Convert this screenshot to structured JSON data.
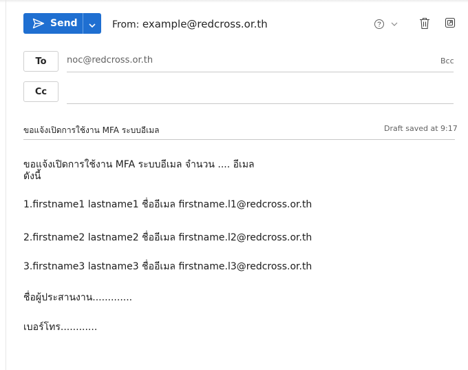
{
  "toolbar": {
    "send_label": "Send",
    "from_prefix": "From:",
    "from_address": "example@redcross.or.th",
    "icons": [
      "send-icon",
      "chevron-down-icon",
      "help-shield-icon",
      "chevron-down-icon",
      "trash-icon",
      "popout-icon"
    ]
  },
  "recipients": {
    "to_label": "To",
    "to_value": "noc@redcross.or.th",
    "cc_label": "Cc",
    "cc_value": "",
    "bcc_label": "Bcc"
  },
  "subject": {
    "value": "ขอแจ้งเปิดการใช้งาน MFA ระบบอีเมล",
    "draft_status": "Draft saved at 9:17"
  },
  "body": {
    "line1": "ขอแจ้งเปิดการใช้งาน MFA ระบบอีเมล จำนวน .... อีเมล",
    "line2": "ดังนี้",
    "item1": "1.firstname1 lastname1 ชื่ออีเมล firstname.l1@redcross.or.th",
    "item2": "2.firstname2 lastname2 ชื่ออีเมล firstname.l2@redcross.or.th",
    "item3": "3.firstname3 lastname3 ชื่ออีเมล firstname.l3@redcross.or.th",
    "coordinator": "ชื่อผู้ประสานงาน.............",
    "phone": "เบอร์โทร............"
  },
  "colors": {
    "accent": "#1f6fd1",
    "text": "#242424",
    "muted": "#616161",
    "divider": "#c8c8c8"
  }
}
